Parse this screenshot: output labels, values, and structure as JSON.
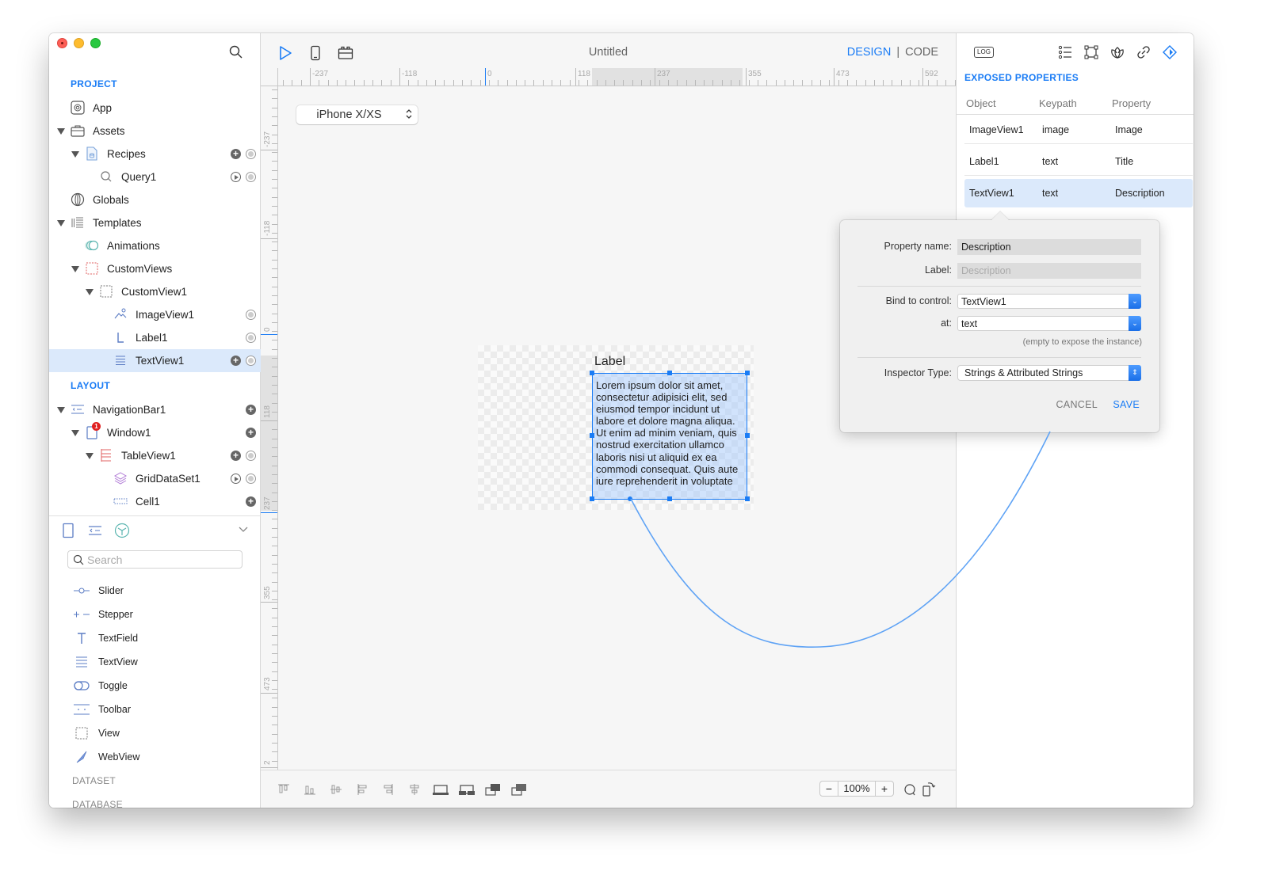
{
  "window": {
    "title": "Untitled"
  },
  "sidebar": {
    "project_title": "PROJECT",
    "layout_title": "LAYOUT",
    "project_items": [
      {
        "label": "App",
        "icon": "app-icon"
      },
      {
        "label": "Assets",
        "icon": "briefcase-icon",
        "expanded": true
      },
      {
        "label": "Recipes",
        "icon": "database-file-icon",
        "expanded": true
      },
      {
        "label": "Query1",
        "icon": "query-icon"
      },
      {
        "label": "Globals",
        "icon": "globe-icon"
      },
      {
        "label": "Templates",
        "icon": "templates-icon",
        "expanded": true
      },
      {
        "label": "Animations",
        "icon": "animations-icon"
      },
      {
        "label": "CustomViews",
        "icon": "customviews-icon",
        "expanded": true
      },
      {
        "label": "CustomView1",
        "icon": "customview-icon",
        "expanded": true
      },
      {
        "label": "ImageView1",
        "icon": "imageview-icon"
      },
      {
        "label": "Label1",
        "icon": "label-icon"
      },
      {
        "label": "TextView1",
        "icon": "textview-icon",
        "selected": true
      }
    ],
    "layout_items": [
      {
        "label": "NavigationBar1",
        "icon": "navigationbar-icon",
        "expanded": true
      },
      {
        "label": "Window1",
        "icon": "window-icon",
        "expanded": true,
        "badge": "1"
      },
      {
        "label": "TableView1",
        "icon": "tableview-icon",
        "expanded": true
      },
      {
        "label": "GridDataSet1",
        "icon": "dataset-icon"
      },
      {
        "label": "Cell1",
        "icon": "cell-icon"
      }
    ]
  },
  "library": {
    "search_placeholder": "Search",
    "search_value": "",
    "items": [
      {
        "label": "Slider",
        "icon": "slider-icon"
      },
      {
        "label": "Stepper",
        "icon": "stepper-icon"
      },
      {
        "label": "TextField",
        "icon": "textfield-icon"
      },
      {
        "label": "TextView",
        "icon": "textview-icon"
      },
      {
        "label": "Toggle",
        "icon": "toggle-icon"
      },
      {
        "label": "Toolbar",
        "icon": "toolbar-icon"
      },
      {
        "label": "View",
        "icon": "view-icon"
      },
      {
        "label": "WebView",
        "icon": "webview-icon"
      }
    ],
    "categories": [
      "DATASET",
      "DATABASE"
    ]
  },
  "toolbar": {
    "title": "Untitled",
    "design_label": "DESIGN",
    "separator": "|",
    "code_label": "CODE"
  },
  "canvas": {
    "device": "iPhone X/XS",
    "ruler_h_labels": [
      "-237",
      "-118",
      "0",
      "118",
      "237",
      "355",
      "473",
      "592"
    ],
    "ruler_v_labels": [
      "-237",
      "-118",
      "0",
      "118",
      "237",
      "355",
      "473",
      "2"
    ],
    "label_text": "Label",
    "textview_text": "Lorem ipsum dolor sit amet, consectetur adipisici elit, sed eiusmod tempor incidunt ut labore et dolore magna aliqua. Ut enim ad minim veniam, quis nostrud exercitation ullamco laboris nisi ut aliquid ex ea commodi consequat. Quis aute iure reprehenderit in voluptate",
    "zoom_value": "100%",
    "zoom_minus": "−",
    "zoom_plus": "+"
  },
  "right_panel": {
    "log_label": "LOG",
    "section_title": "EXPOSED PROPERTIES",
    "columns": [
      "Object",
      "Keypath",
      "Property"
    ],
    "rows": [
      {
        "object": "ImageView1",
        "keypath": "image",
        "property": "Image"
      },
      {
        "object": "Label1",
        "keypath": "text",
        "property": "Title"
      },
      {
        "object": "TextView1",
        "keypath": "text",
        "property": "Description",
        "selected": true
      }
    ]
  },
  "popover": {
    "property_name_label": "Property name:",
    "property_name_value": "Description",
    "label_label": "Label:",
    "label_placeholder": "Description",
    "bind_label": "Bind to control:",
    "bind_value": "TextView1",
    "at_label": "at:",
    "at_value": "text",
    "hint": "(empty to expose the instance)",
    "inspector_label": "Inspector Type:",
    "inspector_value": "Strings & Attributed Strings",
    "cancel_label": "CANCEL",
    "save_label": "SAVE"
  },
  "colors": {
    "accent": "#1a7cf5",
    "selection": "#dbe9fb",
    "connector": "#5fa3f5"
  }
}
